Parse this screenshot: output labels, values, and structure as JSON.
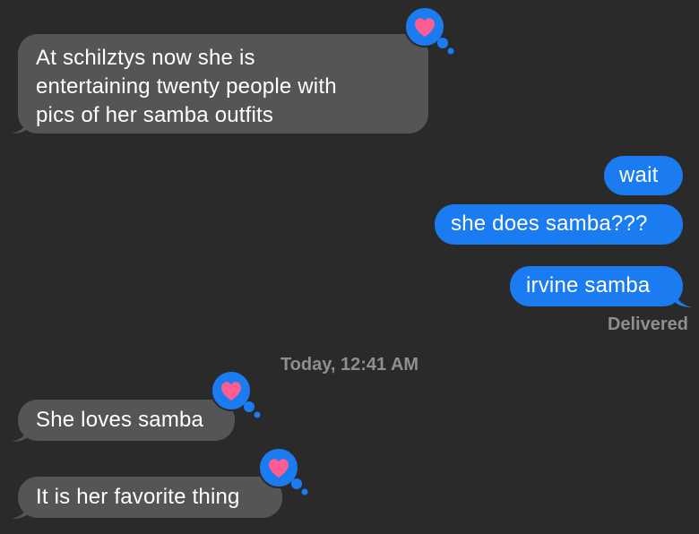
{
  "messages": [
    {
      "direction": "incoming",
      "lines": [
        "At schilztys now she is",
        "entertaining twenty people with",
        "pics of her samba outfits"
      ],
      "reaction": "heart"
    },
    {
      "direction": "outgoing",
      "text": "wait"
    },
    {
      "direction": "outgoing",
      "text": "she does samba???"
    },
    {
      "direction": "outgoing",
      "text": "irvine samba"
    },
    {
      "direction": "incoming",
      "text": "She loves samba",
      "reaction": "heart"
    },
    {
      "direction": "incoming",
      "text": "It is her favorite thing",
      "reaction": "heart"
    }
  ],
  "status": {
    "delivered": "Delivered"
  },
  "timestamp": {
    "prefix": "Today,",
    "time": "12:41 AM"
  },
  "colors": {
    "background": "#2a2a2b",
    "incoming_bubble": "#555557",
    "outgoing_bubble": "#1a7cf0",
    "reaction_badge": "#1a7cf0",
    "heart": "#ff5c93",
    "meta_text": "#8e8e93"
  },
  "icons": {
    "reaction": "heart-icon"
  }
}
